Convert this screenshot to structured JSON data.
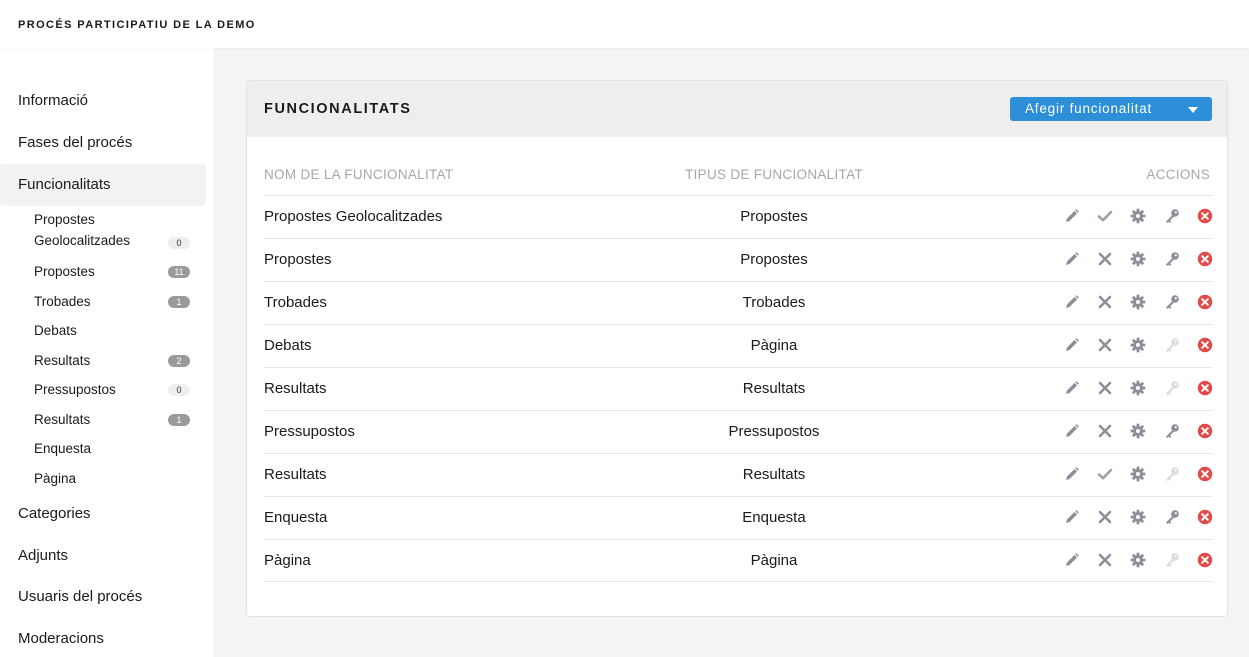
{
  "header": {
    "title": "PROCÉS PARTICIPATIU DE LA DEMO"
  },
  "sidebar": {
    "items_top": [
      {
        "label": "Informació"
      },
      {
        "label": "Fases del procés"
      },
      {
        "label": "Funcionalitats"
      }
    ],
    "components": [
      {
        "label_line1": "Propostes",
        "label_line2": "Geolocalitzades",
        "count": "0"
      },
      {
        "label": "Propostes",
        "count": "11"
      },
      {
        "label": "Trobades",
        "count": "1"
      },
      {
        "label": "Debats"
      },
      {
        "label": "Resultats",
        "count": "2"
      },
      {
        "label": "Pressupostos",
        "count": "0"
      },
      {
        "label": "Resultats",
        "count": "1"
      },
      {
        "label": "Enquesta"
      },
      {
        "label": "Pàgina"
      }
    ],
    "items_bottom": [
      {
        "label": "Categories"
      },
      {
        "label": "Adjunts"
      },
      {
        "label": "Usuaris del procés"
      },
      {
        "label": "Moderacions"
      }
    ]
  },
  "card": {
    "title": "FUNCIONALITATS",
    "add_button": "Afegir funcionalitat",
    "columns": {
      "name": "NOM DE LA FUNCIONALITAT",
      "type": "TIPUS DE FUNCIONALITAT",
      "actions": "ACCIONS"
    },
    "rows": [
      {
        "name": "Propostes Geolocalitzades",
        "type": "Propostes",
        "published": true,
        "permissions_enabled": true
      },
      {
        "name": "Propostes",
        "type": "Propostes",
        "published": false,
        "permissions_enabled": true
      },
      {
        "name": "Trobades",
        "type": "Trobades",
        "published": false,
        "permissions_enabled": true
      },
      {
        "name": "Debats",
        "type": "Pàgina",
        "published": false,
        "permissions_enabled": false
      },
      {
        "name": "Resultats",
        "type": "Resultats",
        "published": false,
        "permissions_enabled": false
      },
      {
        "name": "Pressupostos",
        "type": "Pressupostos",
        "published": false,
        "permissions_enabled": true
      },
      {
        "name": "Resultats",
        "type": "Resultats",
        "published": true,
        "permissions_enabled": false
      },
      {
        "name": "Enquesta",
        "type": "Enquesta",
        "published": false,
        "permissions_enabled": true
      },
      {
        "name": "Pàgina",
        "type": "Pàgina",
        "published": false,
        "permissions_enabled": false
      }
    ]
  },
  "icons": {
    "edit": "pencil-icon",
    "publish": "check-icon",
    "unpublish": "x-icon",
    "configure": "gear-icon",
    "permissions": "key-icon",
    "delete": "delete-circle-icon"
  },
  "colors": {
    "accent": "#2c8fd8",
    "icon_gray": "#8a8f98",
    "icon_disabled": "#d9dce0",
    "delete_red": "#e04a4a",
    "check_gray": "#9aa3ad"
  }
}
